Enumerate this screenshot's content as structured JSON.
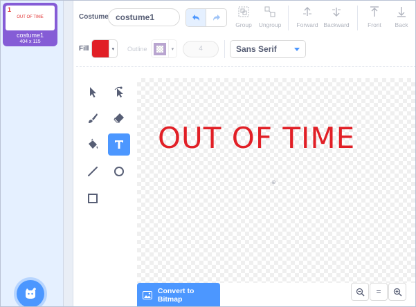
{
  "costume_list": {
    "items": [
      {
        "number": "1",
        "thumb_text": "OUT OF TIME",
        "name": "costume1",
        "size": "404 x 115"
      }
    ],
    "add_button_icon": "cat-add-icon"
  },
  "toolbar": {
    "costume_label": "Costume",
    "costume_name_value": "costume1",
    "group_label": "Group",
    "ungroup_label": "Ungroup",
    "forward_label": "Forward",
    "backward_label": "Backward",
    "front_label": "Front",
    "back_label": "Back"
  },
  "style_row": {
    "fill_label": "Fill",
    "fill_color": "#e11f26",
    "outline_label": "Outline",
    "outline_width": "4",
    "font_value": "Sans Serif"
  },
  "tools": [
    "select-icon",
    "reshape-icon",
    "brush-icon",
    "eraser-icon",
    "fill-icon",
    "text-icon",
    "line-icon",
    "circle-icon",
    "rectangle-icon"
  ],
  "active_tool": "text-icon",
  "canvas": {
    "text": "OUT OF TIME"
  },
  "footer": {
    "convert_label": "Convert to Bitmap",
    "zoom_reset_label": "="
  },
  "colors": {
    "accent": "#4c97ff",
    "selected_costume": "#855cd6",
    "text_red": "#e11f26"
  }
}
